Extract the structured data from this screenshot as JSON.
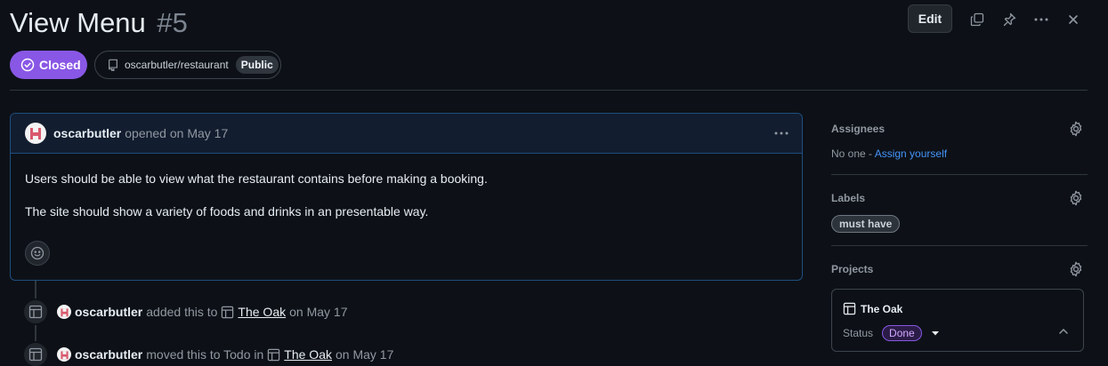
{
  "issue": {
    "title": "View Menu",
    "number": "#5"
  },
  "header": {
    "edit_label": "Edit"
  },
  "state": {
    "label": "Closed"
  },
  "repo": {
    "name": "oscarbutler/restaurant",
    "visibility": "Public"
  },
  "comment": {
    "author": "oscarbutler",
    "action": "opened on May 17",
    "paragraphs": [
      "Users should be able to view what the restaurant contains before making a booking.",
      "The site should show a variety of foods and drinks in an presentable way."
    ]
  },
  "timeline": [
    {
      "actor": "oscarbutler",
      "text": "added this to",
      "project": "The Oak",
      "date": "on May 17"
    },
    {
      "actor": "oscarbutler",
      "text": "moved this to Todo in",
      "project": "The Oak",
      "date": "on May 17"
    }
  ],
  "sidebar": {
    "assignees": {
      "heading": "Assignees",
      "none": "No one - ",
      "assign_link": "Assign yourself"
    },
    "labels": {
      "heading": "Labels",
      "items": [
        "must have"
      ]
    },
    "projects": {
      "heading": "Projects",
      "project_name": "The Oak",
      "status_label": "Status",
      "status_value": "Done"
    }
  },
  "colors": {
    "accent_purple": "#8957e5",
    "link_blue": "#4493f8",
    "comment_border": "#1f4e80"
  }
}
